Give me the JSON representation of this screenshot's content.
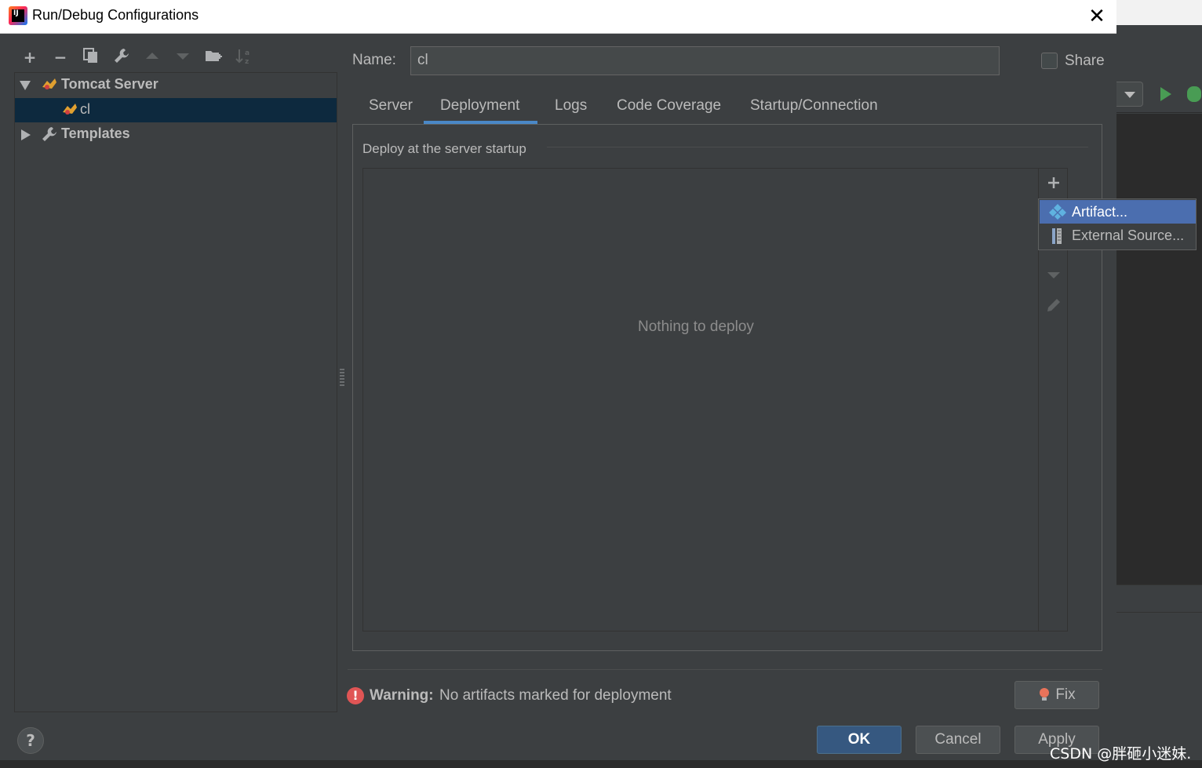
{
  "window": {
    "title": "Run/Debug Configurations",
    "app_icon": "intellij-idea-icon",
    "app_icon_text": "IJ"
  },
  "toolbar": {
    "icons": [
      "add-icon",
      "remove-icon",
      "copy-icon",
      "wrench-icon",
      "move-up-icon",
      "move-down-icon",
      "new-folder-icon",
      "sort-icon"
    ]
  },
  "tree": {
    "items": [
      {
        "label": "Tomcat Server",
        "icon": "tomcat-icon",
        "expanded": true
      },
      {
        "label": "cl",
        "icon": "tomcat-config-icon",
        "selected": true
      },
      {
        "label": "Templates",
        "icon": "wrench-icon",
        "expanded": false
      }
    ]
  },
  "config": {
    "name_label": "Name:",
    "name_value": "cl",
    "share_label": "Share",
    "share_checked": false
  },
  "tabs": {
    "items": [
      "Server",
      "Deployment",
      "Logs",
      "Code Coverage",
      "Startup/Connection"
    ],
    "active": "Deployment"
  },
  "deployment": {
    "section_title": "Deploy at the server startup",
    "empty_text": "Nothing to deploy",
    "actions": [
      "add-icon",
      "move-down-icon",
      "edit-icon"
    ]
  },
  "popup_menu": {
    "items": [
      {
        "label": "Artifact...",
        "icon": "artifact-icon",
        "selected": true
      },
      {
        "label": "External Source...",
        "icon": "external-source-icon",
        "selected": false
      }
    ]
  },
  "warning": {
    "strong": "Warning:",
    "text": "No artifacts marked for deployment",
    "fix_label": "Fix"
  },
  "buttons": {
    "ok": "OK",
    "cancel": "Cancel",
    "apply": "Apply",
    "help": "?"
  },
  "watermark": "CSDN @胖砸小迷妹.",
  "colors": {
    "dialog_bg": "#3c3f41",
    "selection": "#0d293e",
    "popup_selection": "#4b6eaf",
    "tab_underline": "#4a88c7",
    "primary_button": "#365880",
    "error_red": "#e05555"
  }
}
